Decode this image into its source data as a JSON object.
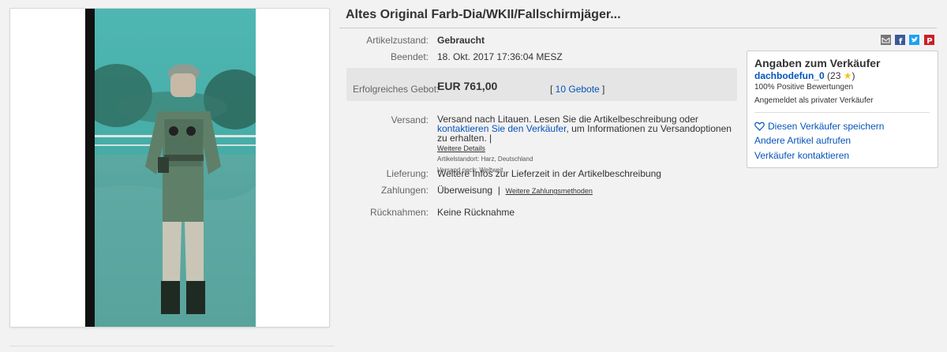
{
  "listing": {
    "title": "Altes Original Farb-Dia/WKII/Fallschirmjäger..."
  },
  "details": {
    "condition_label": "Artikelzustand:",
    "condition_value": "Gebraucht",
    "ended_label": "Beendet:",
    "ended_value": "18. Okt. 2017  17:36:04 MESZ",
    "winning_bid_label": "Erfolgreiches Gebot:",
    "winning_bid_value": "EUR 761,00",
    "bid_count_open": "[ ",
    "bid_count_link": "10 Gebote",
    "bid_count_close": " ]",
    "shipping_label": "Versand:",
    "shipping_text_1": "Versand nach Litauen. Lesen Sie die Artikelbeschreibung oder ",
    "shipping_link": "kontaktieren Sie den Verkäufer",
    "shipping_text_2": ", um Informationen zu Versandoptionen zu erhalten. |",
    "more_details_link": "Weitere Details",
    "item_location": "Artikelstandort:  Harz, Deutschland",
    "ships_to": "Versand nach:  Weltweit",
    "delivery_label": "Lieferung:",
    "delivery_value": "Weitere Infos zur Lieferzeit in der Artikelbeschreibung",
    "payment_label": "Zahlungen:",
    "payment_value": "Überweisung",
    "payment_separator": "|",
    "payment_more_link": "Weitere Zahlungsmethoden",
    "returns_label": "Rücknahmen:",
    "returns_value": "Keine Rücknahme"
  },
  "share": {
    "icons": [
      "email-icon",
      "facebook-icon",
      "twitter-icon",
      "pinterest-icon"
    ]
  },
  "seller": {
    "title": "Angaben zum Verkäufer",
    "name": "dachbodefun_0",
    "feedback_open": " (23 ",
    "feedback_close": ")",
    "positive": "100% Positive Bewertungen",
    "registered": "Angemeldet als privater Verkäufer",
    "save_seller": "Diesen Verkäufer speichern",
    "other_items": "Andere Artikel aufrufen",
    "contact": "Verkäufer kontaktieren"
  },
  "colors": {
    "link": "#0654ba",
    "facebook": "#3b5998",
    "twitter": "#1da1f2",
    "pinterest": "#cb2027",
    "star": "#f5c518"
  }
}
